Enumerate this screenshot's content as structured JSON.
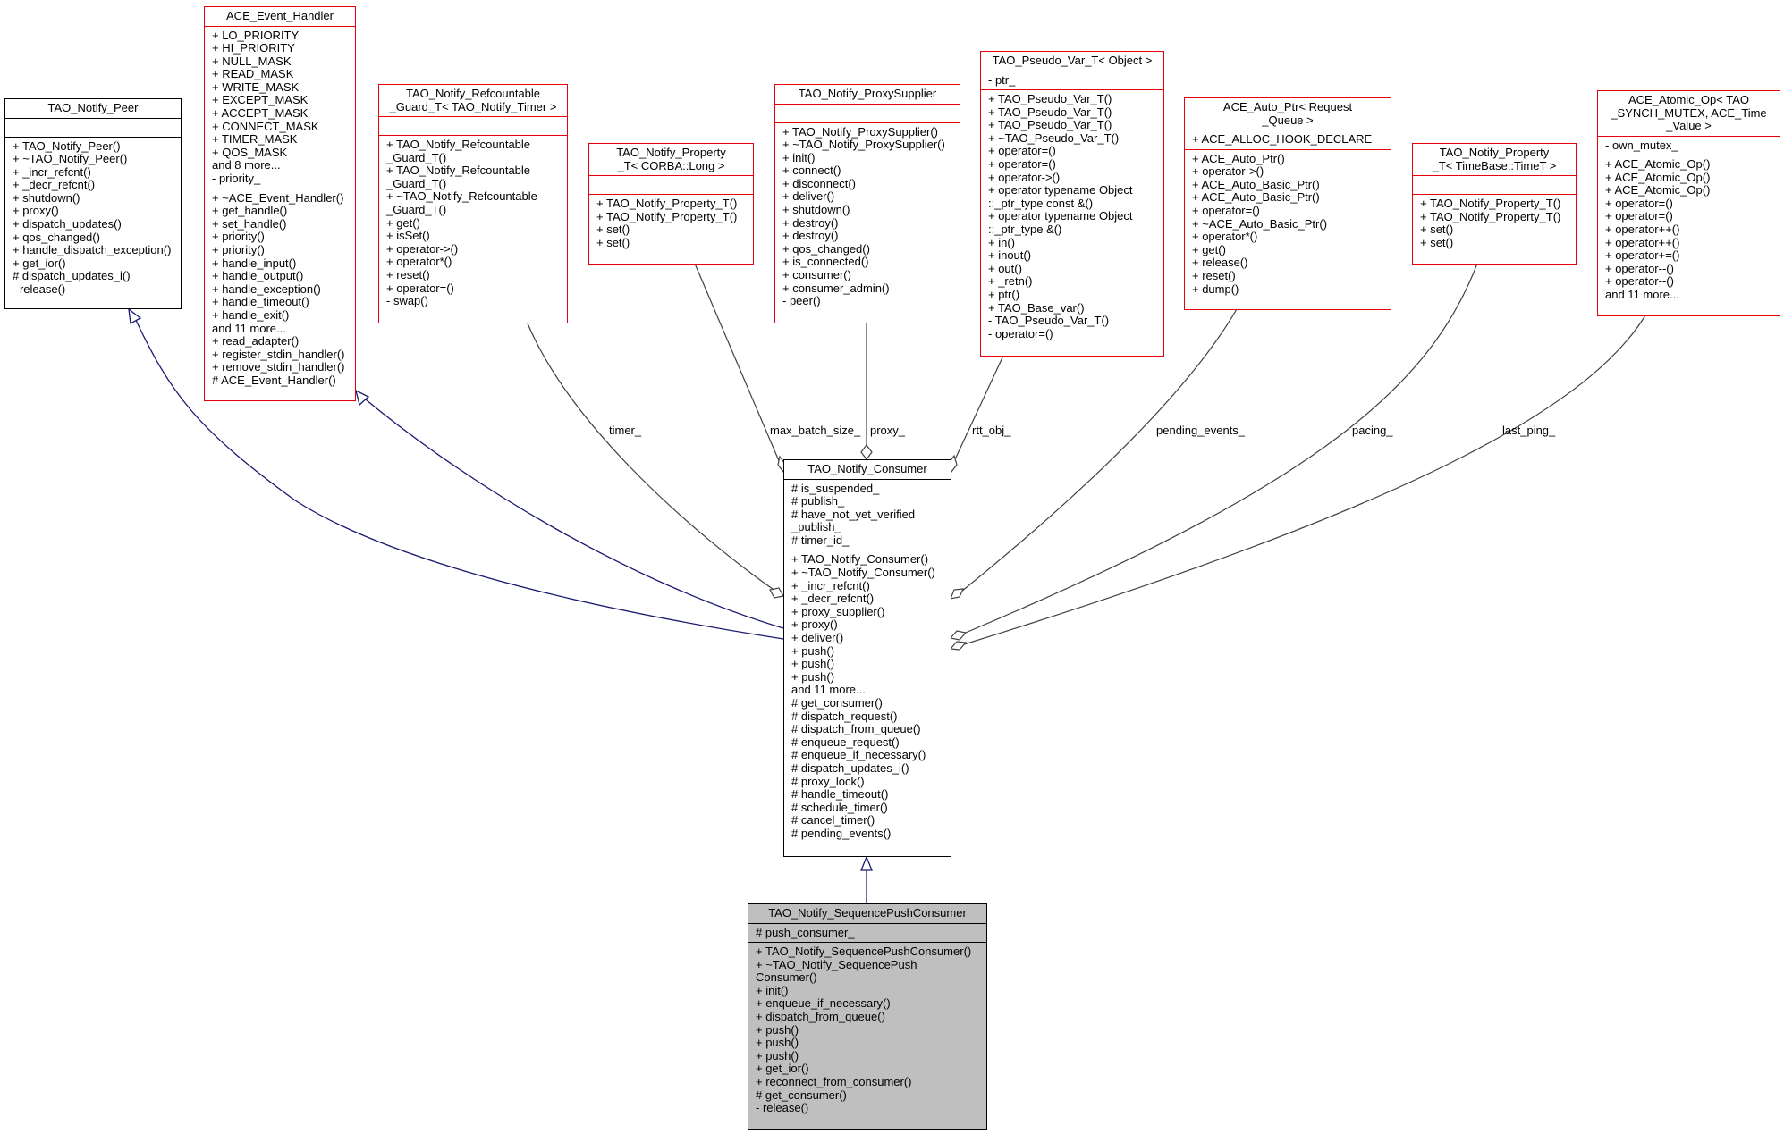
{
  "classes": {
    "peer": {
      "title": "TAO_Notify_Peer",
      "attrs": [],
      "ops": [
        "+ TAO_Notify_Peer()",
        "+ ~TAO_Notify_Peer()",
        "+ _incr_refcnt()",
        "+ _decr_refcnt()",
        "+ shutdown()",
        "+ proxy()",
        "+ dispatch_updates()",
        "+ qos_changed()",
        "+ handle_dispatch_exception()",
        "+ get_ior()",
        "# dispatch_updates_i()",
        "- release()"
      ]
    },
    "event_handler": {
      "title": "ACE_Event_Handler",
      "attrs": [
        "+ LO_PRIORITY",
        "+ HI_PRIORITY",
        "+ NULL_MASK",
        "+ READ_MASK",
        "+ WRITE_MASK",
        "+ EXCEPT_MASK",
        "+ ACCEPT_MASK",
        "+ CONNECT_MASK",
        "+ TIMER_MASK",
        "+ QOS_MASK",
        "and 8 more...",
        "- priority_"
      ],
      "ops": [
        "+ ~ACE_Event_Handler()",
        "+ get_handle()",
        "+ set_handle()",
        "+ priority()",
        "+ priority()",
        "+ handle_input()",
        "+ handle_output()",
        "+ handle_exception()",
        "+ handle_timeout()",
        "+ handle_exit()",
        "and 11 more...",
        "+ read_adapter()",
        "+ register_stdin_handler()",
        "+ remove_stdin_handler()",
        "# ACE_Event_Handler()"
      ]
    },
    "refcountable_guard": {
      "title": "TAO_Notify_Refcountable\n_Guard_T< TAO_Notify_Timer >",
      "attrs": [],
      "ops": [
        "+ TAO_Notify_Refcountable",
        "_Guard_T()",
        "+ TAO_Notify_Refcountable",
        "_Guard_T()",
        "+ ~TAO_Notify_Refcountable",
        "_Guard_T()",
        "+ get()",
        "+ isSet()",
        "+ operator->()",
        "+ operator*()",
        "+ reset()",
        "+ operator=()",
        "- swap()"
      ]
    },
    "property_long": {
      "title": "TAO_Notify_Property\n_T< CORBA::Long >",
      "attrs": [],
      "ops": [
        "+ TAO_Notify_Property_T()",
        "+ TAO_Notify_Property_T()",
        "+ set()",
        "+ set()"
      ]
    },
    "proxy_supplier": {
      "title": "TAO_Notify_ProxySupplier",
      "attrs": [],
      "ops": [
        "+ TAO_Notify_ProxySupplier()",
        "+ ~TAO_Notify_ProxySupplier()",
        "+ init()",
        "+ connect()",
        "+ disconnect()",
        "+ deliver()",
        "+ shutdown()",
        "+ destroy()",
        "+ destroy()",
        "+ qos_changed()",
        "+ is_connected()",
        "+ consumer()",
        "+ consumer_admin()",
        "- peer()"
      ]
    },
    "pseudo_var": {
      "title": "TAO_Pseudo_Var_T< Object >",
      "attrs": [
        "- ptr_"
      ],
      "ops": [
        "+ TAO_Pseudo_Var_T()",
        "+ TAO_Pseudo_Var_T()",
        "+ TAO_Pseudo_Var_T()",
        "+ ~TAO_Pseudo_Var_T()",
        "+ operator=()",
        "+ operator=()",
        "+ operator->()",
        "+ operator typename Object",
        "::_ptr_type const &()",
        "+ operator typename Object",
        "::_ptr_type &()",
        "+ in()",
        "+ inout()",
        "+ out()",
        "+ _retn()",
        "+ ptr()",
        "+ TAO_Base_var()",
        "- TAO_Pseudo_Var_T()",
        "- operator=()"
      ]
    },
    "auto_ptr": {
      "title": "ACE_Auto_Ptr< Request\n_Queue >",
      "attrs": [
        "+ ACE_ALLOC_HOOK_DECLARE"
      ],
      "ops": [
        "+ ACE_Auto_Ptr()",
        "+ operator->()",
        "+ ACE_Auto_Basic_Ptr()",
        "+ ACE_Auto_Basic_Ptr()",
        "+ operator=()",
        "+ ~ACE_Auto_Basic_Ptr()",
        "+ operator*()",
        "+ get()",
        "+ release()",
        "+ reset()",
        "+ dump()"
      ]
    },
    "property_timet": {
      "title": "TAO_Notify_Property\n_T< TimeBase::TimeT >",
      "attrs": [],
      "ops": [
        "+ TAO_Notify_Property_T()",
        "+ TAO_Notify_Property_T()",
        "+ set()",
        "+ set()"
      ]
    },
    "atomic_op": {
      "title": "ACE_Atomic_Op< TAO\n_SYNCH_MUTEX, ACE_Time\n_Value >",
      "attrs": [
        "- own_mutex_"
      ],
      "ops": [
        "+ ACE_Atomic_Op()",
        "+ ACE_Atomic_Op()",
        "+ ACE_Atomic_Op()",
        "+ operator=()",
        "+ operator=()",
        "+ operator++()",
        "+ operator++()",
        "+ operator+=()",
        "+ operator--()",
        "+ operator--()",
        "and 11 more..."
      ]
    },
    "consumer": {
      "title": "TAO_Notify_Consumer",
      "attrs": [
        "# is_suspended_",
        "# publish_",
        "# have_not_yet_verified",
        "_publish_",
        "# timer_id_"
      ],
      "ops": [
        "+ TAO_Notify_Consumer()",
        "+ ~TAO_Notify_Consumer()",
        "+ _incr_refcnt()",
        "+ _decr_refcnt()",
        "+ proxy_supplier()",
        "+ proxy()",
        "+ deliver()",
        "+ push()",
        "+ push()",
        "+ push()",
        "and 11 more...",
        "# get_consumer()",
        "# dispatch_request()",
        "# dispatch_from_queue()",
        "# enqueue_request()",
        "# enqueue_if_necessary()",
        "# dispatch_updates_i()",
        "# proxy_lock()",
        "# handle_timeout()",
        "# schedule_timer()",
        "# cancel_timer()",
        "# pending_events()"
      ]
    },
    "sequence_push_consumer": {
      "title": "TAO_Notify_SequencePushConsumer",
      "attrs": [
        "# push_consumer_"
      ],
      "ops": [
        "+ TAO_Notify_SequencePushConsumer()",
        "+ ~TAO_Notify_SequencePush",
        "Consumer()",
        "+ init()",
        "+ enqueue_if_necessary()",
        "+ dispatch_from_queue()",
        "+ push()",
        "+ push()",
        "+ push()",
        "+ get_ior()",
        "+ reconnect_from_consumer()",
        "# get_consumer()",
        "- release()"
      ]
    }
  },
  "edge_labels": {
    "timer": "timer_",
    "max_batch_size": "max_batch_size_",
    "proxy": "proxy_",
    "rtt_obj": "rtt_obj_",
    "pending_events": "pending_events_",
    "pacing": "pacing_",
    "last_ping": "last_ping_"
  },
  "colors": {
    "inheritance_edge": "#191970",
    "association_edge": "#404040",
    "template_border": "#e8000b",
    "focus_fill": "#bfbfbf"
  }
}
